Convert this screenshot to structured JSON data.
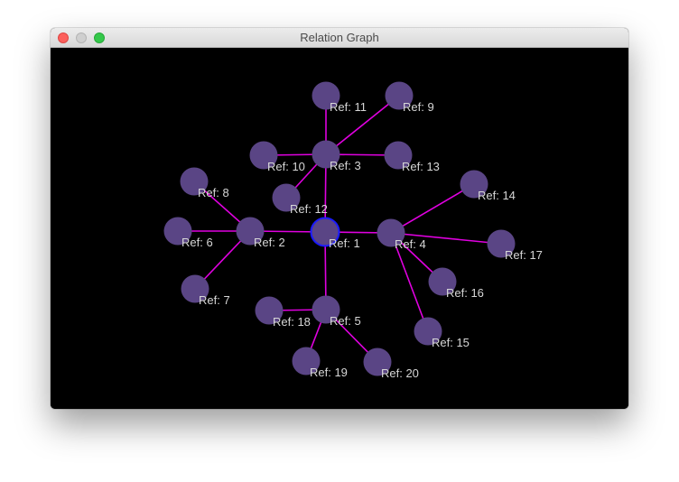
{
  "window": {
    "title": "Relation Graph"
  },
  "graph": {
    "colors": {
      "background": "#000000",
      "node_fill": "#5a4585",
      "selected_stroke": "#1a1aff",
      "edge": "#e000e0",
      "label": "#d7d7d7"
    },
    "selected": "1",
    "nodes": [
      {
        "id": "1",
        "label": "Ref: 1"
      },
      {
        "id": "2",
        "label": "Ref: 2"
      },
      {
        "id": "3",
        "label": "Ref: 3"
      },
      {
        "id": "4",
        "label": "Ref: 4"
      },
      {
        "id": "5",
        "label": "Ref: 5"
      },
      {
        "id": "6",
        "label": "Ref: 6"
      },
      {
        "id": "7",
        "label": "Ref: 7"
      },
      {
        "id": "8",
        "label": "Ref: 8"
      },
      {
        "id": "9",
        "label": "Ref: 9"
      },
      {
        "id": "10",
        "label": "Ref: 10"
      },
      {
        "id": "11",
        "label": "Ref: 11"
      },
      {
        "id": "12",
        "label": "Ref: 12"
      },
      {
        "id": "13",
        "label": "Ref: 13"
      },
      {
        "id": "14",
        "label": "Ref: 14"
      },
      {
        "id": "15",
        "label": "Ref: 15"
      },
      {
        "id": "16",
        "label": "Ref: 16"
      },
      {
        "id": "17",
        "label": "Ref: 17"
      },
      {
        "id": "18",
        "label": "Ref: 18"
      },
      {
        "id": "19",
        "label": "Ref: 19"
      },
      {
        "id": "20",
        "label": "Ref: 20"
      }
    ],
    "edges": [
      [
        "1",
        "2"
      ],
      [
        "1",
        "3"
      ],
      [
        "1",
        "4"
      ],
      [
        "1",
        "5"
      ],
      [
        "2",
        "6"
      ],
      [
        "2",
        "7"
      ],
      [
        "2",
        "8"
      ],
      [
        "3",
        "9"
      ],
      [
        "3",
        "10"
      ],
      [
        "3",
        "11"
      ],
      [
        "3",
        "12"
      ],
      [
        "3",
        "13"
      ],
      [
        "4",
        "14"
      ],
      [
        "4",
        "15"
      ],
      [
        "4",
        "16"
      ],
      [
        "4",
        "17"
      ],
      [
        "5",
        "18"
      ],
      [
        "5",
        "19"
      ],
      [
        "5",
        "20"
      ]
    ]
  }
}
